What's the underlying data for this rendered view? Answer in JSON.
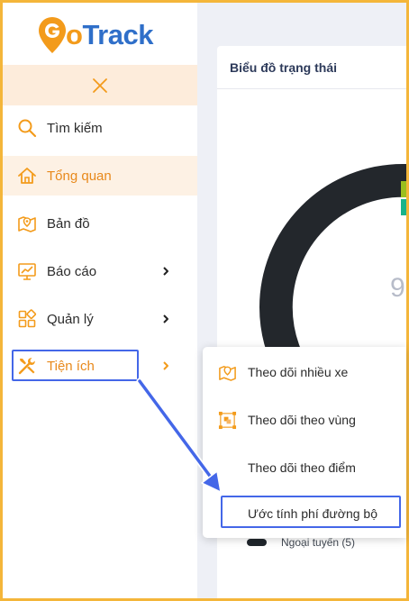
{
  "brand": {
    "logo_text_prefix": "G",
    "logo_text_o": "o",
    "logo_text_rest": "Track",
    "primary_color": "#2f6fc9",
    "accent_color": "#f39b1b"
  },
  "sidebar": {
    "collapse_icon": "close-icon",
    "items": [
      {
        "label": "Tìm kiếm",
        "icon": "search-icon"
      },
      {
        "label": "Tổng quan",
        "icon": "home-icon",
        "active": true
      },
      {
        "label": "Bản đồ",
        "icon": "map-icon"
      },
      {
        "label": "Báo cáo",
        "icon": "chart-icon",
        "has_submenu": true
      },
      {
        "label": "Quản lý",
        "icon": "grid-icon",
        "has_submenu": true
      },
      {
        "label": "Tiện ích",
        "icon": "tools-icon",
        "has_submenu": true,
        "highlighted": true
      }
    ]
  },
  "card": {
    "title": "Biểu đồ trạng thái",
    "center_value": "9",
    "legend": [
      {
        "label": "Ngoại tuyến (5)",
        "color": "#1f252b"
      }
    ]
  },
  "submenu": {
    "items": [
      {
        "label": "Theo dõi nhiều xe",
        "icon": "map-pin-icon"
      },
      {
        "label": "Theo dõi theo vùng",
        "icon": "region-select-icon"
      },
      {
        "label": "Theo dõi theo điểm",
        "icon": ""
      },
      {
        "label": "Ước tính phí đường bộ",
        "icon": "",
        "highlighted": true
      }
    ]
  },
  "annotation": {
    "highlight_color": "#4467e8"
  }
}
